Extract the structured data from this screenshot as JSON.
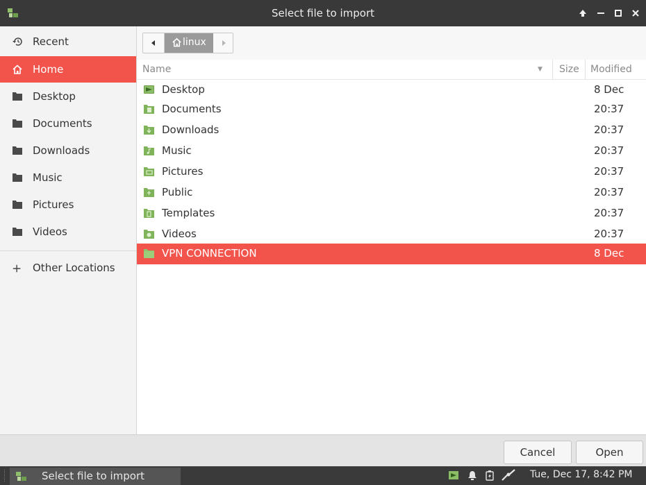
{
  "window": {
    "title": "Select file to import"
  },
  "sidebar": {
    "items": [
      {
        "label": "Recent",
        "icon": "recent-icon"
      },
      {
        "label": "Home",
        "icon": "home-icon"
      },
      {
        "label": "Desktop",
        "icon": "folder-icon"
      },
      {
        "label": "Documents",
        "icon": "folder-icon"
      },
      {
        "label": "Downloads",
        "icon": "folder-icon"
      },
      {
        "label": "Music",
        "icon": "folder-icon"
      },
      {
        "label": "Pictures",
        "icon": "folder-icon"
      },
      {
        "label": "Videos",
        "icon": "folder-icon"
      }
    ],
    "other_locations": "Other Locations",
    "active_item": "Home"
  },
  "pathbar": {
    "current": "linux"
  },
  "columns": {
    "name": "Name",
    "size": "Size",
    "modified": "Modified"
  },
  "files": [
    {
      "name": "Desktop",
      "modified": "8 Dec",
      "icon": "desktop-folder-icon"
    },
    {
      "name": "Documents",
      "modified": "20:37",
      "icon": "documents-folder-icon"
    },
    {
      "name": "Downloads",
      "modified": "20:37",
      "icon": "downloads-folder-icon"
    },
    {
      "name": "Music",
      "modified": "20:37",
      "icon": "music-folder-icon"
    },
    {
      "name": "Pictures",
      "modified": "20:37",
      "icon": "pictures-folder-icon"
    },
    {
      "name": "Public",
      "modified": "20:37",
      "icon": "public-folder-icon"
    },
    {
      "name": "Templates",
      "modified": "20:37",
      "icon": "templates-folder-icon"
    },
    {
      "name": "Videos",
      "modified": "20:37",
      "icon": "videos-folder-icon"
    },
    {
      "name": "VPN CONNECTION",
      "modified": "8 Dec",
      "icon": "folder-icon",
      "selected": true
    }
  ],
  "actions": {
    "cancel": "Cancel",
    "open": "Open"
  },
  "taskbar": {
    "task_label": "Select file to import",
    "clock": "Tue, Dec 17,  8:42 PM"
  },
  "colors": {
    "accent": "#f2544c",
    "folder_green": "#7fb45a",
    "titlebar": "#393939"
  }
}
